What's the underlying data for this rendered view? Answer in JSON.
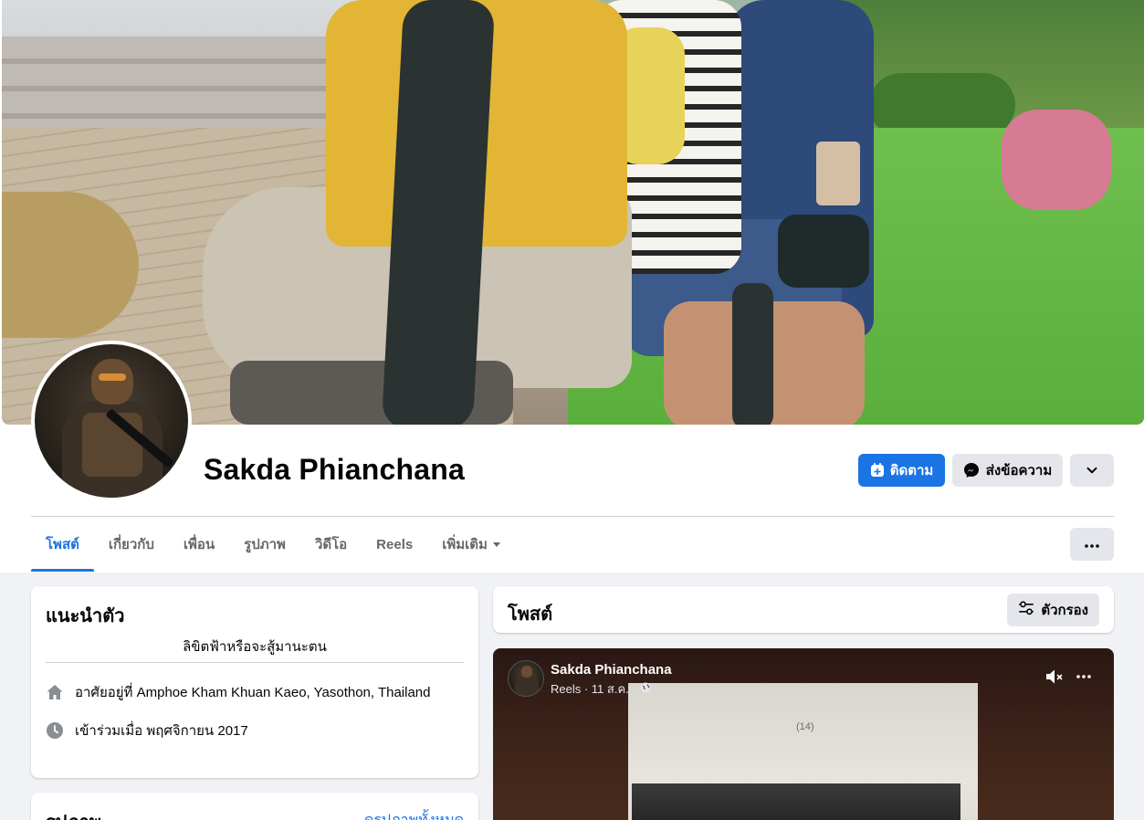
{
  "profile": {
    "name": "Sakda Phianchana",
    "follow_label": "ติดตาม",
    "message_label": "ส่งข้อความ"
  },
  "tabs": [
    {
      "label": "โพสต์",
      "active": true
    },
    {
      "label": "เกี่ยวกับ"
    },
    {
      "label": "เพื่อน"
    },
    {
      "label": "รูปภาพ"
    },
    {
      "label": "วิดีโอ"
    },
    {
      "label": "Reels"
    },
    {
      "label": "เพิ่มเติม"
    }
  ],
  "intro": {
    "title": "แนะนำตัว",
    "bio": "ลิขิตฟ้าหรือจะสู้มานะตน",
    "lives_in": "อาศัยอยู่ที่ Amphoe Kham Khuan Kaeo, Yasothon, Thailand",
    "joined": "เข้าร่วมเมื่อ พฤศจิกายน 2017"
  },
  "photos": {
    "title": "รูปภาพ",
    "see_all": "ดูรูปภาพทั้งหมด"
  },
  "posts": {
    "title": "โพสต์",
    "filter_label": "ตัวกรอง"
  },
  "reel_post": {
    "author": "Sakda Phianchana",
    "meta": "Reels · 11 ส.ค. ·",
    "page_number": "(14)"
  },
  "colors": {
    "accent": "#1b74e4",
    "button_gray": "#e4e6eb",
    "page_bg": "#f0f2f5"
  },
  "icons": {
    "follow": "add-friend-icon",
    "message": "messenger-icon",
    "more": "chevron-down-icon",
    "tabs_more": "ellipsis-icon",
    "home": "home-icon",
    "clock": "clock-icon",
    "filter": "filter-icon",
    "globe": "globe-icon",
    "mute": "muted-speaker-icon"
  }
}
